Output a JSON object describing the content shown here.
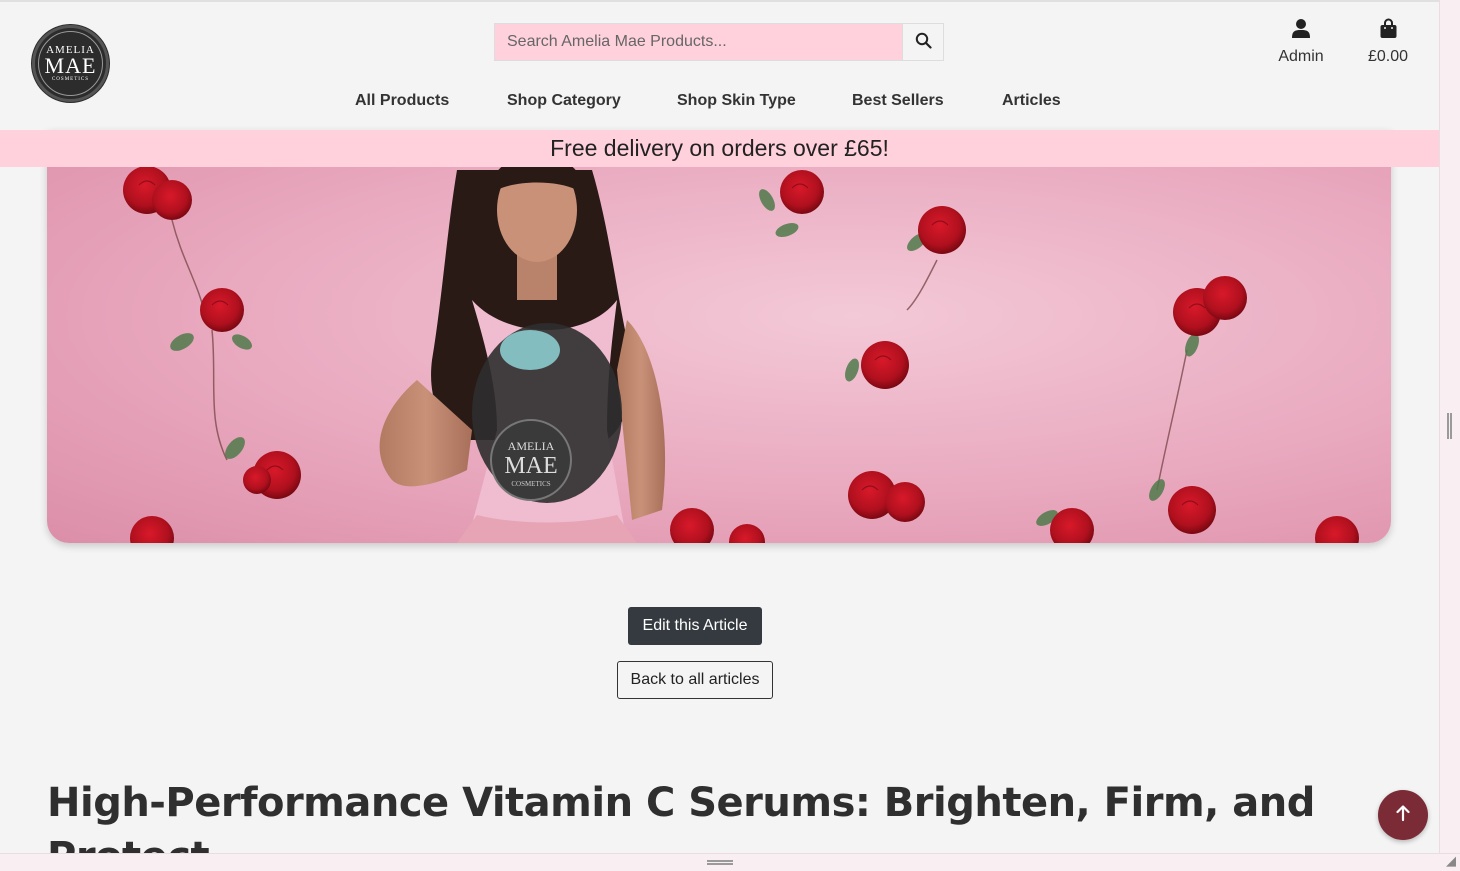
{
  "brand": {
    "logo_line1": "AMELIA",
    "logo_line2": "MAE",
    "logo_line3": "COSMETICS"
  },
  "search": {
    "placeholder": "Search Amelia Mae Products...",
    "icon": "search-icon"
  },
  "account": {
    "admin_label": "Admin",
    "admin_icon": "user-icon",
    "bag_total": "£0.00",
    "bag_icon": "shopping-bag-icon"
  },
  "nav": {
    "items": [
      {
        "label": "All Products"
      },
      {
        "label": "Shop Category"
      },
      {
        "label": "Shop Skin Type"
      },
      {
        "label": "Best Sellers"
      },
      {
        "label": "Articles"
      }
    ]
  },
  "promo": {
    "text": "Free delivery on orders over £65!"
  },
  "hero": {
    "shirt_logo_line1": "AMELIA",
    "shirt_logo_line2": "MAE",
    "shirt_logo_line3": "COSMETICS"
  },
  "actions": {
    "edit_label": "Edit this Article",
    "back_label": "Back to all articles"
  },
  "article": {
    "title": "High-Performance Vitamin C Serums: Brighten, Firm, and Protect"
  },
  "colors": {
    "promo_bg": "#ffd1dc",
    "search_bg": "#ffd1dc",
    "edit_btn_bg": "#343a40",
    "to_top_bg": "#7a2b36",
    "page_bg": "#f4f4f4"
  },
  "scroll_top": {
    "icon": "arrow-up-icon"
  }
}
